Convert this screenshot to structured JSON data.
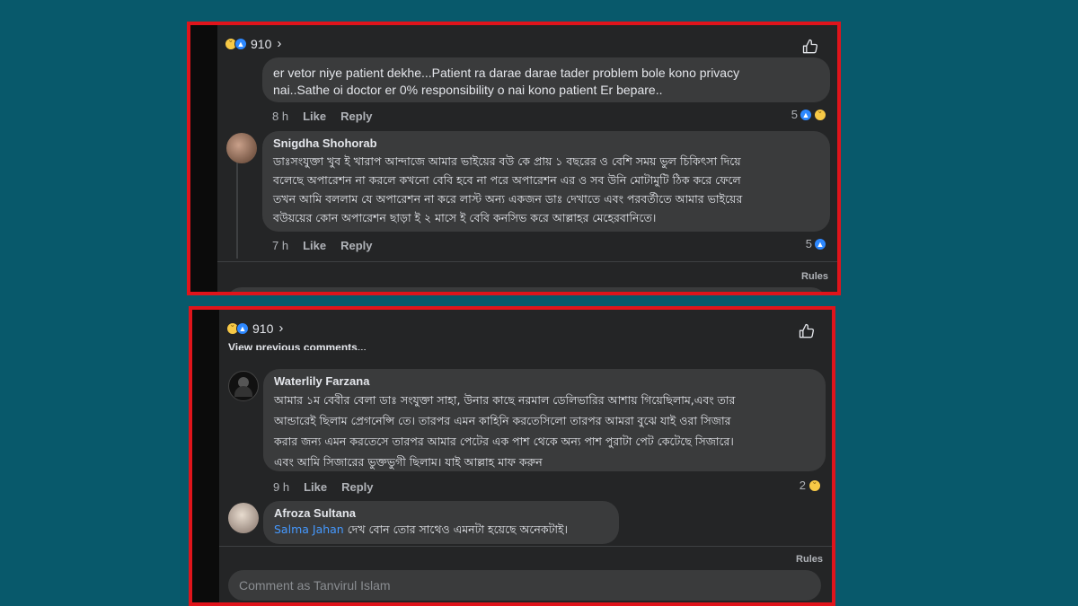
{
  "top": {
    "reaction_count": "910",
    "comment1": {
      "text_line1": "er vetor niye patient dekhe...Patient ra darae darae tader problem bole kono privacy",
      "text_line2": "nai..Sathe oi doctor er 0% responsibility o nai kono patient Er bepare..",
      "time": "8 h",
      "like": "Like",
      "reply": "Reply",
      "reactions": "5"
    },
    "comment2": {
      "author": "Snigdha Shohorab",
      "line1": "ডাঃসংযুক্তা খুব ই খারাপ আন্দাজে আমার ভাইয়ের বউ কে প্রায় ১ বছরের ও বেশি সময় ভুল চিকিৎসা দিয়ে",
      "line2": "বলেছে অপারেশন না করলে কখনো বেবি হবে না পরে অপারেশন এর ও সব উনি মোটামুটি ঠিক করে ফেলে",
      "line3": "তখন আমি বললাম যে অপারেশন না করে লাস্ট অন্য একজন ডাঃ দেখাতে এবং পরবর্তীতে আমার ভাইয়ের",
      "line4": "বউয়য়ের কোন অপারেশন ছাড়া ই ২ মাসে ই বেবি কনসিভ করে আল্লাহর মেহেরবানিতে।",
      "time": "7 h",
      "like": "Like",
      "reply": "Reply",
      "reactions": "5"
    },
    "rules": "Rules"
  },
  "bottom": {
    "reaction_count": "910",
    "view_previous": "View previous comments...",
    "comment1": {
      "author": "Waterlily Farzana",
      "line1": "আমার ১ম বেবীর বেলা ডাঃ সংযুক্তা সাহা, উনার কাছে নরমাল ডেলিভারির আশায় গিয়েছিলাম,এবং তার",
      "line2": "আন্ডারেই ছিলাম প্রেগনেন্সি তে। তারপর এমন কাহিনি করতেসিলো তারপর আমরা বুঝে যাই ওরা সিজার",
      "line3": "করার জন্য এমন করতেসে তারপর আমার পেটের এক পাশ থেকে অন্য পাশ পুরাটা পেট কেটেছে সিজারে।",
      "line4": "এবং আমি সিজারের ভুক্তভুগী  ছিলাম। যাই আল্লাহ মাফ করুন",
      "time": "9 h",
      "like": "Like",
      "reply": "Reply",
      "reactions": "2"
    },
    "comment2": {
      "author": "Afroza Sultana",
      "mention": "Salma Jahan",
      "text": " দেখ বোন তোর সাথেও এমনটা হয়েছে অনেকটাই।"
    },
    "rules": "Rules",
    "compose_placeholder": "Comment as Tanvirul Islam"
  }
}
